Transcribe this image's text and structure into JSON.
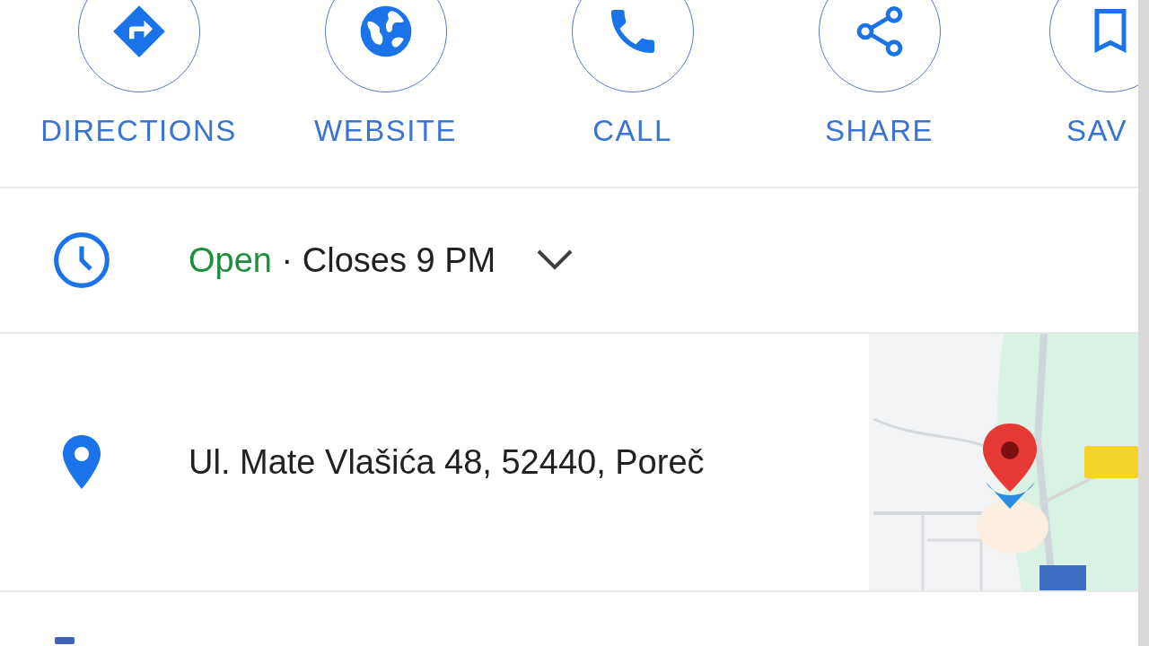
{
  "actions": [
    {
      "label": "DIRECTIONS",
      "kind": "directions"
    },
    {
      "label": "WEBSITE",
      "kind": "website"
    },
    {
      "label": "CALL",
      "kind": "call"
    },
    {
      "label": "SHARE",
      "kind": "share"
    },
    {
      "label": "SAV",
      "kind": "save"
    }
  ],
  "hours": {
    "status": "Open",
    "detail": "· Closes 9 PM",
    "expanded": false
  },
  "address": {
    "text": "Ul. Mate Vlašića 48, 52440, Poreč"
  }
}
